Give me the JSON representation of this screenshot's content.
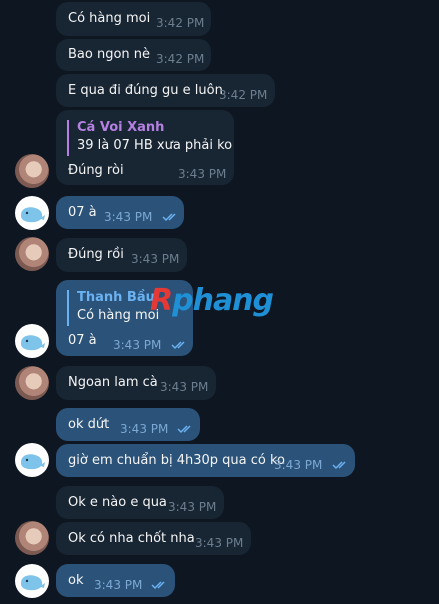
{
  "messages": [
    {
      "text": "Có hàng moi",
      "time": "3:42 PM"
    },
    {
      "text": "Bao ngon nè",
      "time": "3:42 PM"
    },
    {
      "text": "E qua đi đúng gu e luôn",
      "time": "3:42 PM"
    },
    {
      "reply_name": "Cá Voi Xanh",
      "reply_text": "39 là 07 HB xưa phải ko",
      "text": "Đúng ròi",
      "time": "3:43 PM"
    },
    {
      "text": "07 à",
      "time": "3:43 PM"
    },
    {
      "text": "Đúng rồi",
      "time": "3:43 PM"
    },
    {
      "reply_name": "Thanh Bầu",
      "reply_text": "Có hàng moi",
      "text": "07 à",
      "time": "3:43 PM"
    },
    {
      "text": "Ngoan lam cà",
      "time": "3:43 PM"
    },
    {
      "text": "ok dứt",
      "time": "3:43 PM"
    },
    {
      "text": "giờ em chuẩn bị 4h30p qua có ko",
      "time": "3:43 PM"
    },
    {
      "text": "Ok e nào e qua",
      "time": "3:43 PM"
    },
    {
      "text": "Ok có nha chốt nha",
      "time": "3:43 PM"
    },
    {
      "text": "ok",
      "time": "3:43 PM"
    }
  ],
  "watermark": {
    "first": "R",
    "rest": "phang"
  },
  "colors": {
    "background": "#0e1621",
    "incoming_bubble": "#182533",
    "outgoing_bubble": "#2b5278",
    "reply_accent": "#6ab2f2"
  }
}
